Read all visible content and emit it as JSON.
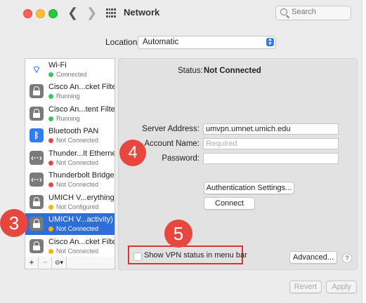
{
  "window": {
    "title": "Network"
  },
  "toolbar": {
    "back_glyph": "❮",
    "forward_glyph": "❯",
    "search_placeholder": "Search"
  },
  "location": {
    "label": "Location:",
    "value": "Automatic"
  },
  "services": [
    {
      "name": "Wi-Fi",
      "status": "Connected",
      "status_color": "#34c759",
      "icon": "wifi-icon"
    },
    {
      "name": "Cisco An...cket Filter",
      "status": "Running",
      "status_color": "#34c759",
      "icon": "lock-icon"
    },
    {
      "name": "Cisco An...tent Filter",
      "status": "Running",
      "status_color": "#34c759",
      "icon": "lock-icon"
    },
    {
      "name": "Bluetooth PAN",
      "status": "Not Connected",
      "status_color": "#e8473f",
      "icon": "bluetooth-icon"
    },
    {
      "name": "Thunder...lt Ethernet",
      "status": "Not Connected",
      "status_color": "#e8473f",
      "icon": "ethernet-icon"
    },
    {
      "name": "Thunderbolt Bridge",
      "status": "Not Connected",
      "status_color": "#e8473f",
      "icon": "ethernet-icon"
    },
    {
      "name": "UMICH V...erything)",
      "status": "Not Configured",
      "status_color": "#f5b400",
      "icon": "lock-icon"
    },
    {
      "name": "UMICH V...activity)",
      "status": "Not Connected",
      "status_color": "#f5b400",
      "icon": "lock-icon",
      "selected": true
    },
    {
      "name": "Cisco An...cket Filter",
      "status": "Not Connected",
      "status_color": "#f5b400",
      "icon": "lock-icon"
    }
  ],
  "sidebar_footer": {
    "add": "+",
    "remove": "−",
    "action": "⊝▾"
  },
  "detail": {
    "status_label": "Status:",
    "status_value": "Not Connected",
    "server_label": "Server Address:",
    "server_value": "umvpn.umnet.umich.edu",
    "account_label": "Account Name:",
    "account_placeholder": "Required",
    "password_label": "Password:",
    "auth_button": "Authentication Settings...",
    "connect_button": "Connect",
    "show_vpn_label": "Show VPN status in menu bar",
    "advanced_button": "Advanced...",
    "help_button": "?",
    "revert_button": "Revert",
    "apply_button": "Apply"
  },
  "callouts": {
    "three": "3",
    "four": "4",
    "five": "5"
  },
  "colors": {
    "accent": "#2c6fd8",
    "callout": "#e8473f"
  }
}
